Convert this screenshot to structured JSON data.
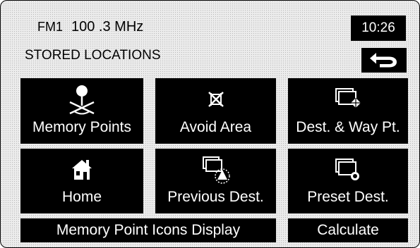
{
  "status": {
    "band": "FM1",
    "frequency": "100 .3 MHz",
    "time": "10:26"
  },
  "header": {
    "title": "STORED LOCATIONS",
    "back_icon": "back-arrow-icon"
  },
  "tiles": [
    {
      "label": "Memory Points",
      "icon": "memory-points-icon"
    },
    {
      "label": "Avoid Area",
      "icon": "avoid-area-icon"
    },
    {
      "label": "Dest. & Way Pt.",
      "icon": "destination-waypoint-icon"
    },
    {
      "label": "Home",
      "icon": "home-icon"
    },
    {
      "label": "Previous Dest.",
      "icon": "previous-destination-icon"
    },
    {
      "label": "Preset Dest.",
      "icon": "preset-destination-icon"
    }
  ],
  "bottom": {
    "memory_icons_label": "Memory Point Icons Display",
    "calculate_label": "Calculate"
  },
  "colors": {
    "button_bg": "#000000",
    "button_text": "#ffffff",
    "screen_bg": "#ececec"
  }
}
